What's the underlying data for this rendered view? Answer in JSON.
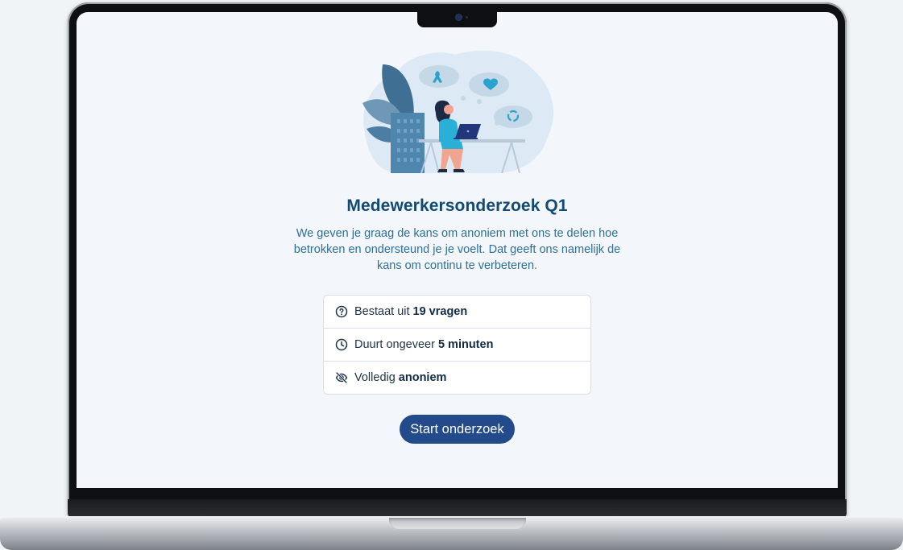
{
  "survey": {
    "title": "Medewerkersonderzoek Q1",
    "description": "We geven je graag de kans om anoniem met ons te delen hoe betrokken en ondersteund je je voelt. Dat geeft ons namelijk de kans om continu te verbeteren.",
    "details": [
      {
        "icon": "question-circle-icon",
        "text": "Bestaat uit",
        "emphasis": "19 vragen"
      },
      {
        "icon": "clock-icon",
        "text": "Duurt ongeveer",
        "emphasis": "5 minuten"
      },
      {
        "icon": "eye-off-icon",
        "text": "Volledig",
        "emphasis": "anoniem"
      }
    ],
    "start_label": "Start onderzoek"
  },
  "colors": {
    "title": "#134a73",
    "body_text": "#2e6f9a",
    "button": "#234a8a",
    "screen_background": "#f3f7fb"
  }
}
